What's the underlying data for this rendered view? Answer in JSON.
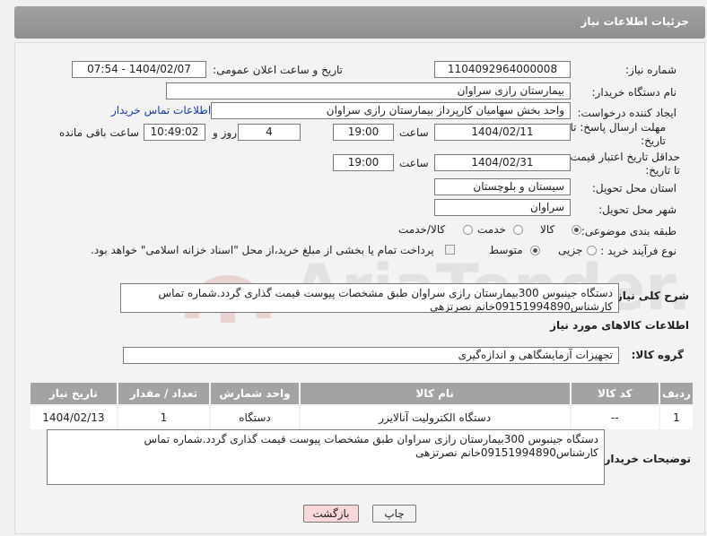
{
  "header": {
    "title": "جزئیات اطلاعات نیاز"
  },
  "fields": {
    "need_number_label": "شماره نیاز:",
    "need_number": "1104092964000008",
    "announce_label": "تاریخ و ساعت اعلان عمومی:",
    "announce_value": "1404/02/07 - 07:54",
    "buyer_org_label": "نام دستگاه خریدار:",
    "buyer_org": "بیمارستان رازی سراوان",
    "creator_label": "ایجاد کننده درخواست:",
    "creator": "واحد بخش  سهامیان کارپرداز بیمارستان رازی سراوان",
    "contact_link": "اطلاعات تماس خریدار",
    "deadline_label": "مهلت ارسال پاسخ: تا تاریخ:",
    "deadline_date": "1404/02/11",
    "time_label": "ساعت",
    "deadline_time": "19:00",
    "days_value": "4",
    "days_label": "روز و",
    "remaining_time": "10:49:02",
    "remaining_label": "ساعت باقی مانده",
    "price_validity_label": "حداقل تاریخ اعتبار قیمت: تا تاریخ:",
    "price_validity_date": "1404/02/31",
    "price_validity_time": "19:00",
    "province_label": "استان محل تحویل:",
    "province": "سیستان و بلوچستان",
    "city_label": "شهر محل تحویل:",
    "city": "سراوان",
    "category_label": "طبقه بندی موضوعی:",
    "category_options": [
      "کالا",
      "خدمت",
      "کالا/خدمت"
    ],
    "category_selected": "کالا",
    "process_label": "نوع فرآیند خرید :",
    "process_options": [
      "جزیی",
      "متوسط"
    ],
    "process_selected": "متوسط",
    "payment_note": "پرداخت تمام یا بخشی از مبلغ خرید،از محل \"اسناد خزانه اسلامی\" خواهد بود.",
    "description_label": "شرح کلی نیاز:",
    "description": "دستگاه جینبوس 300بیمارستان رازی سراوان طبق مشخصات پیوست قیمت گذاری گردد.شماره تماس کارشناس09151994890خانم نصرتزهی"
  },
  "goods": {
    "section_title": "اطلاعات کالاهای مورد نیاز",
    "group_label": "گروه کالا:",
    "group_value": "تجهیزات آزمایشگاهی و اندازه‌گیری",
    "columns": [
      "ردیف",
      "کد کالا",
      "نام کالا",
      "واحد شمارش",
      "تعداد / مقدار",
      "تاریخ نیاز"
    ],
    "rows": [
      [
        "1",
        "--",
        "دستگاه الکترولیت آنالایزر",
        "دستگاه",
        "1",
        "1404/02/13"
      ]
    ]
  },
  "buyer_notes": {
    "label": "توضیحات خریدار:",
    "text": "دستگاه جینبوس 300بیمارستان رازی سراوان طبق مشخصات پیوست قیمت گذاری گردد.شماره تماس کارشناس09151994890خانم نصرتزهی"
  },
  "buttons": {
    "print": "چاپ",
    "back": "بازگشت"
  },
  "watermark": "AriaTender.neT",
  "colors": {
    "header": "#999999",
    "link": "#1a3ea8",
    "back_button": "#f7d7d7"
  }
}
